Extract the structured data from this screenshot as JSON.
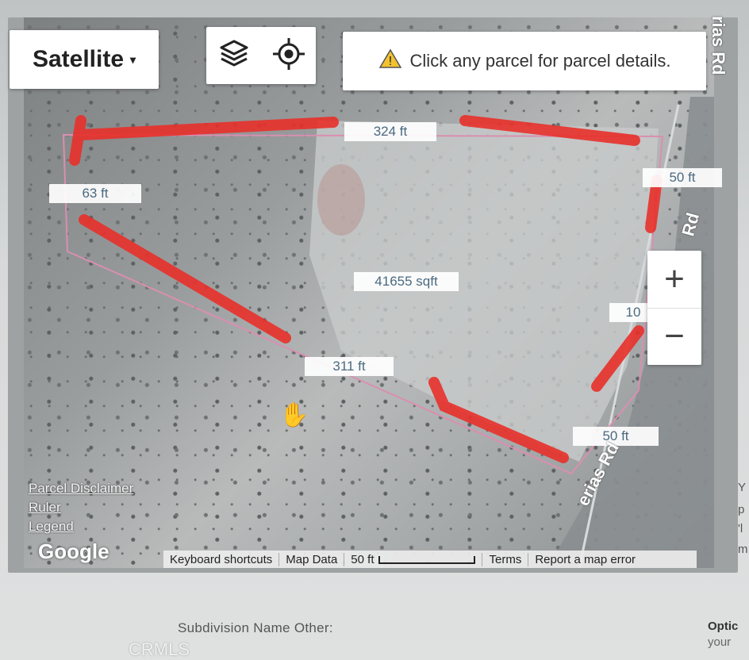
{
  "map_type_button": {
    "label": "Satellite",
    "caret": "▾"
  },
  "toolbar": {
    "layers_icon": "layers-icon",
    "locate_icon": "locate-target-icon"
  },
  "hint": {
    "warning_icon": "warning-icon",
    "text": "Click any parcel for parcel details."
  },
  "zoom": {
    "in_label": "+",
    "out_label": "−"
  },
  "measurements": {
    "top": "324 ft",
    "left": "63 ft",
    "right_top": "50 ft",
    "area": "41655 sqft",
    "right_mid": "10",
    "bottom": "311 ft",
    "bottom_right": "50 ft"
  },
  "roads": {
    "top_right": "rias Rd",
    "right": "Rd",
    "bottom": "erias Rd"
  },
  "side_links": [
    "Parcel Disclaimer",
    "Ruler",
    "Legend"
  ],
  "google_logo": "Google",
  "footer": {
    "keyboard": "Keyboard shortcuts",
    "map_data": "Map Data",
    "scale": "50 ft",
    "terms": "Terms",
    "report": "Report a map error"
  },
  "page": {
    "subdivision_label": "Subdivision Name Other:",
    "watermark": "CRMLS",
    "option_label": "Optic",
    "option_sub": "your",
    "right_frags": [
      "Y",
      "p",
      "'l",
      "m"
    ]
  },
  "colors": {
    "markup_red": "#e8302a",
    "parcel_line": "#d98fb0",
    "label_text": "#4a6a80"
  }
}
